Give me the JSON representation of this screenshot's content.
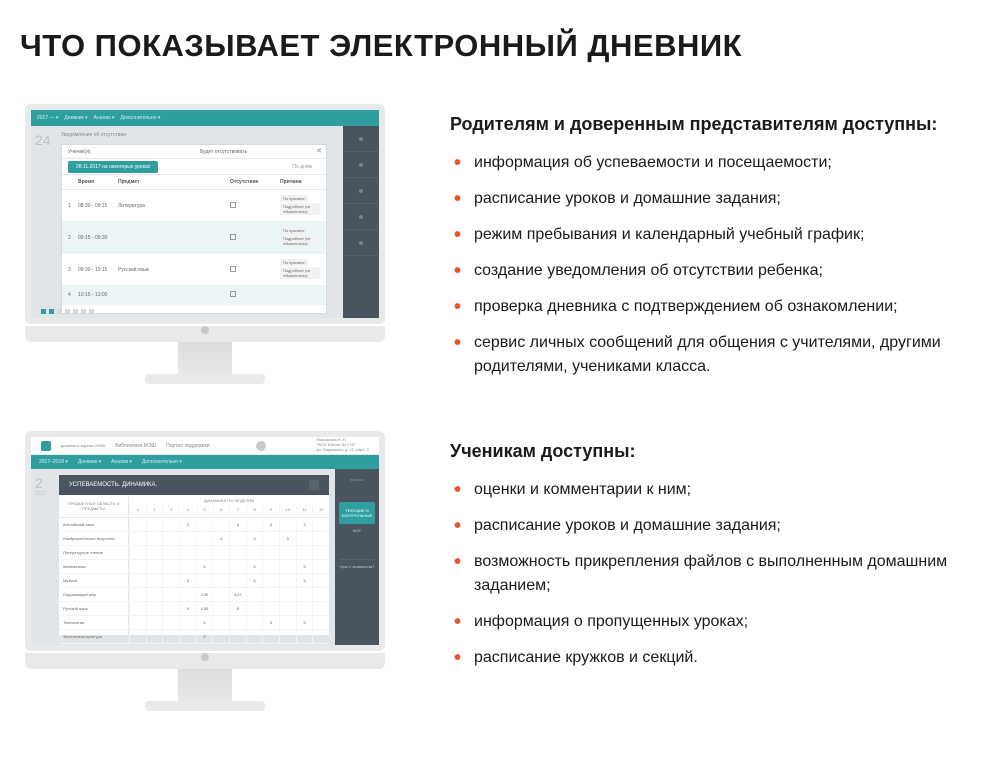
{
  "title": "ЧТО ПОКАЗЫВАЕТ ЭЛЕКТРОННЫЙ ДНЕВНИК",
  "section1": {
    "heading": "Родителям и доверенным представителям доступны:",
    "bullets": [
      "информация об успеваемости и посещаемости;",
      "расписание уроков и домашние задания;",
      "режим пребывания и календарный учебный график;",
      "создание уведомления об отсутствии ребенка;",
      "проверка дневника с подтверждением об ознакомлении;",
      "сервис личных сообщений для общения с учителями, другими родителями, учениками класса."
    ]
  },
  "section2": {
    "heading": "Ученикам доступны:",
    "bullets": [
      "оценки и комментарии к ним;",
      "расписание уроков и домашние задания;",
      "возможность прикрепления файлов с выполненным домашним заданием;",
      "информация о пропущенных уроках;",
      "расписание кружков и секций."
    ]
  },
  "screen1": {
    "topbar": {
      "year": "2017 — ▾",
      "menu1": "Дневник ▾",
      "menu2": "Анализ ▾",
      "menu3": "Дополнительно ▾"
    },
    "big_number": "24",
    "page_caption": "Уведомление об отсутствии",
    "popup_header_left": "Ученик(и)",
    "popup_header_right": "Будет отсутствовать",
    "tab_active": "28.11.2017 на некоторых уроках",
    "tab_other": "По дням",
    "columns": {
      "num": "",
      "time": "Время",
      "subject": "Предмет",
      "absent": "Отсутствие",
      "reason": "Причина"
    },
    "rows": [
      {
        "n": "1",
        "time": "08:30 - 09:15",
        "subject": "Литература",
        "reason_top": "По причине",
        "reason_bottom": "Подробнее (не обязательно)"
      },
      {
        "n": "2",
        "time": "09:15 - 09:30",
        "subject": "",
        "reason_top": "По причине",
        "reason_bottom": "Подробнее (не обязательно)"
      },
      {
        "n": "3",
        "time": "09:30 - 10:15",
        "subject": "Русский язык",
        "reason_top": "По причине",
        "reason_bottom": "Подробнее (не обязательно)"
      },
      {
        "n": "4",
        "time": "10:15 - 13:00",
        "subject": "",
        "reason_top": "",
        "reason_bottom": ""
      }
    ]
  },
  "screen2": {
    "top_logo_text": "дневник\nи журнал\nМЭШ",
    "top_link1": "Библиотека МЭШ",
    "top_link2": "Портал поддержки",
    "user_name": "Максакова Н. П.",
    "user_school": "ГБОУ Школа № 1747",
    "user_address": "ул. Барышиха, д. 21, корп. 2",
    "menubar": {
      "year": "2017–2018 ▾",
      "m1": "Дневник ▾",
      "m2": "Анализ ▾",
      "m3": "Дополнительно ▾"
    },
    "big_number": "2",
    "big_year": "2017",
    "panel_title": "УСПЕВАЕМОСТЬ. ДИНАМИКА.",
    "side_label": "Классы",
    "side_btn1": "ТЕКУЩИЕ И КОНТРОЛЬНЫЕ",
    "side_btn2": "ВСЕ",
    "side_btn3": "Урок с экзаменом?",
    "table": {
      "rowhead": "ПРЕДМЕТНАЯ ОБЛАСТЬ И ПРЕДМЕТЫ",
      "colhead": "ДИНАМИКА ПО НЕДЕЛЯМ",
      "cols": [
        "1",
        "2",
        "3",
        "4",
        "5",
        "6",
        "7",
        "8",
        "9",
        "10",
        "11",
        "12"
      ],
      "subjects": [
        {
          "name": "Английский язык",
          "vals": [
            "",
            "",
            "",
            "3",
            "",
            "",
            "5",
            "",
            "5",
            "",
            "3",
            ""
          ]
        },
        {
          "name": "Изобразительное искусство",
          "vals": [
            "",
            "",
            "",
            "",
            "",
            "4",
            "",
            "5",
            "",
            "5",
            "",
            ""
          ]
        },
        {
          "name": "Литературное чтение",
          "vals": [
            "",
            "",
            "",
            "",
            "",
            "",
            "",
            "",
            "",
            "",
            "",
            ""
          ]
        },
        {
          "name": "Математика",
          "vals": [
            "",
            "",
            "",
            "",
            "5",
            "",
            "",
            "5",
            "",
            "",
            "5",
            ""
          ]
        },
        {
          "name": "Музыка",
          "vals": [
            "",
            "",
            "",
            "5",
            "",
            "",
            "",
            "5",
            "",
            "",
            "5",
            ""
          ]
        },
        {
          "name": "Окружающий мир",
          "vals": [
            "",
            "",
            "",
            "",
            "4,55",
            "",
            "4,57",
            "",
            "",
            "",
            "",
            ""
          ]
        },
        {
          "name": "Русский язык",
          "vals": [
            "",
            "",
            "",
            "4",
            "4,55",
            "",
            "5",
            "",
            "",
            "",
            "",
            ""
          ]
        },
        {
          "name": "Технология",
          "vals": [
            "",
            "",
            "",
            "",
            "5",
            "",
            "",
            "",
            "5",
            "",
            "5",
            ""
          ]
        },
        {
          "name": "Физическая культура",
          "vals": [
            "",
            "",
            "",
            "",
            "5",
            "",
            "",
            "",
            "",
            "",
            "",
            ""
          ]
        }
      ]
    }
  }
}
